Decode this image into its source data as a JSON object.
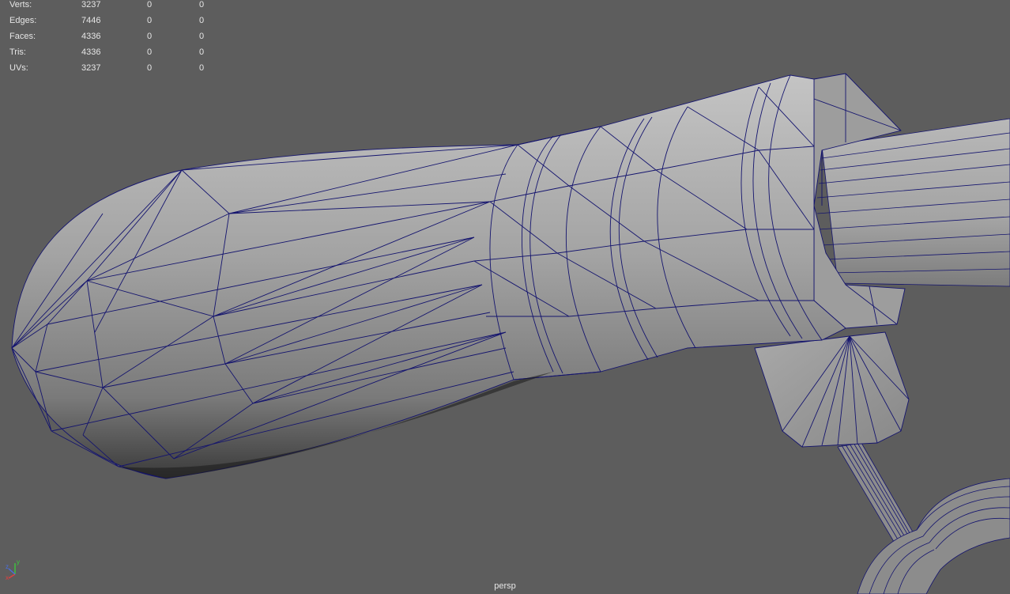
{
  "hud": {
    "rows": [
      {
        "label": "Verts:",
        "value": "3237",
        "selected": "0",
        "selected_uv": "0"
      },
      {
        "label": "Edges:",
        "value": "7446",
        "selected": "0",
        "selected_uv": "0"
      },
      {
        "label": "Faces:",
        "value": "4336",
        "selected": "0",
        "selected_uv": "0"
      },
      {
        "label": "Tris:",
        "value": "4336",
        "selected": "0",
        "selected_uv": "0"
      },
      {
        "label": "UVs:",
        "value": "3237",
        "selected": "0",
        "selected_uv": "0"
      }
    ]
  },
  "viewport": {
    "camera": "persp",
    "background_color": "#5d5d5d",
    "wireframe_color": "#14146e",
    "surface_color": "#8e8e8e"
  },
  "axis_gizmo": {
    "x": "x",
    "y": "y",
    "z": "z"
  }
}
